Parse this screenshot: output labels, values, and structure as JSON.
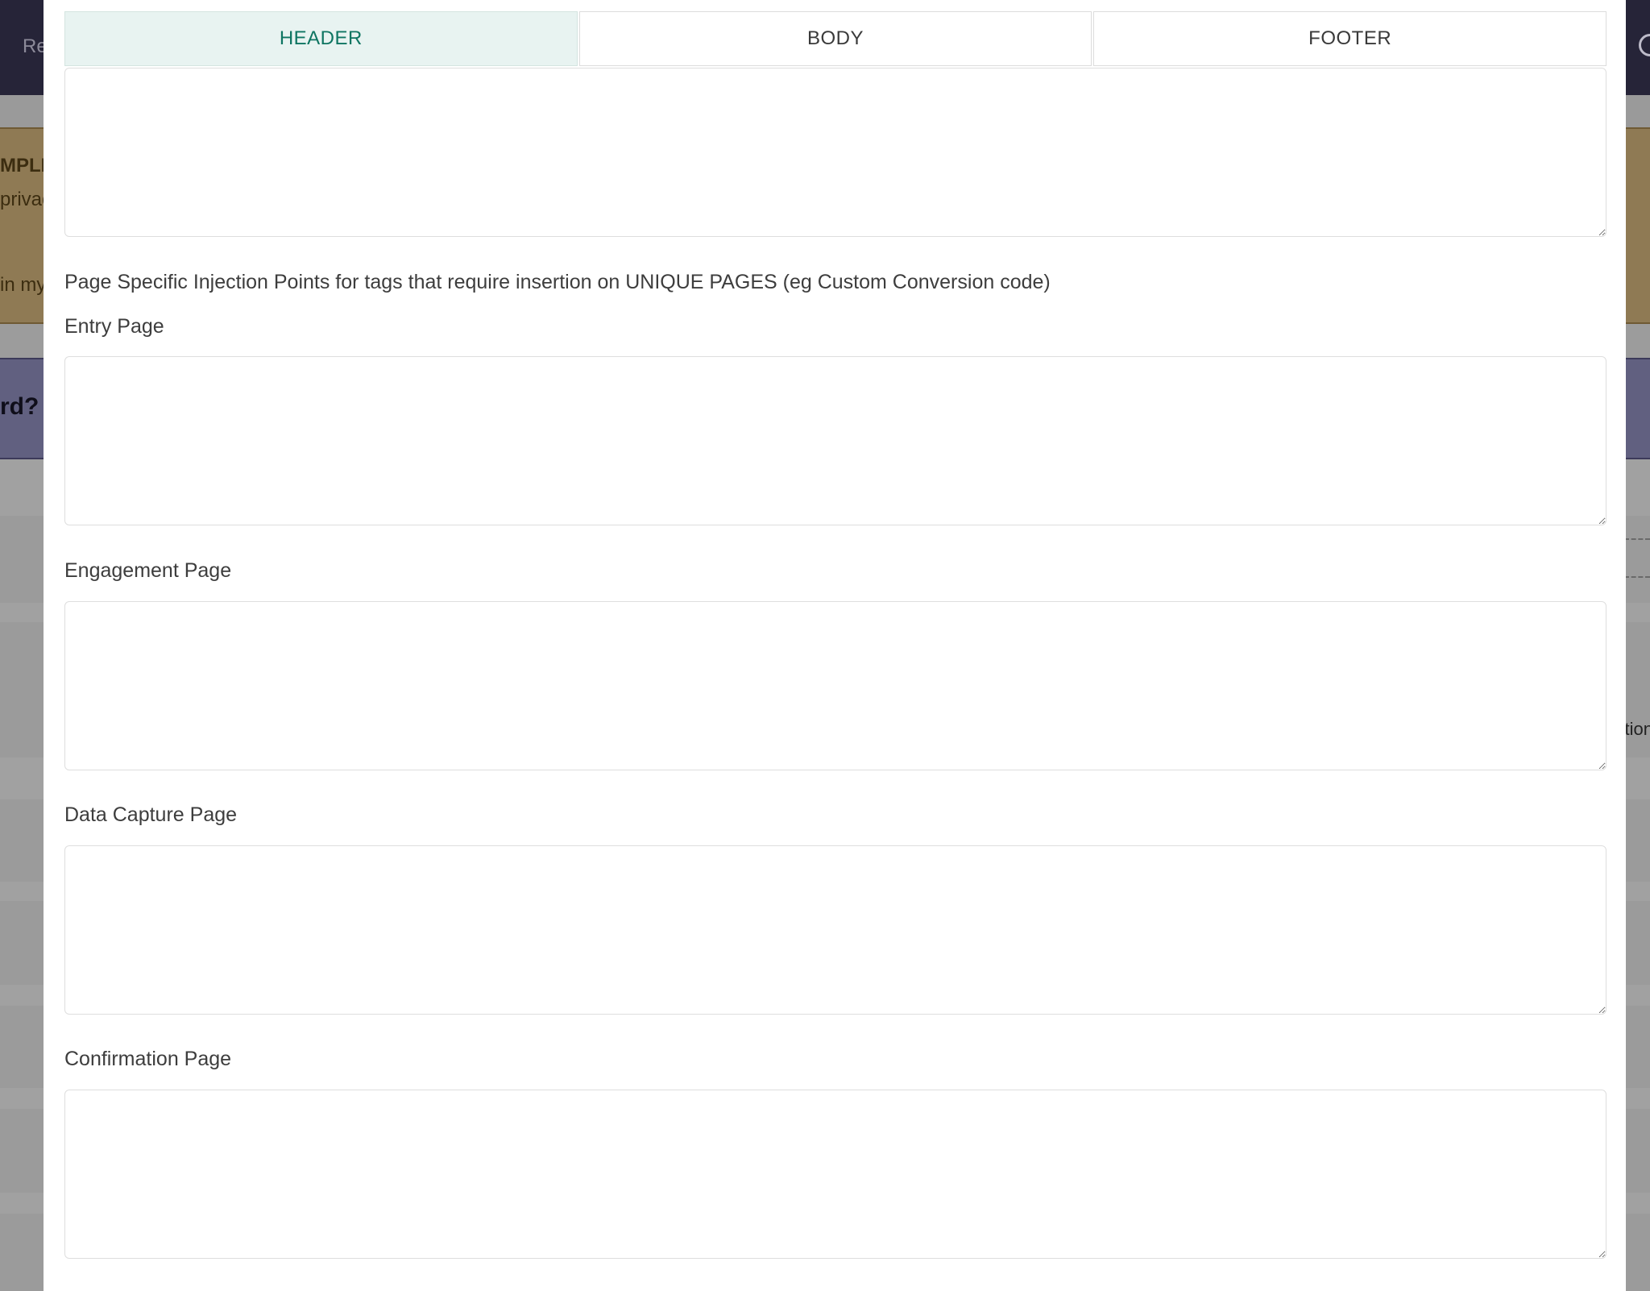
{
  "background": {
    "topbar_text": "Re",
    "compliance_title": "MPLIA",
    "compliance_line1": "privac",
    "compliance_line2": "in my",
    "purple_heading": "rd?",
    "right_text": "tion"
  },
  "tabs": [
    {
      "label": "HEADER",
      "active": true
    },
    {
      "label": "BODY",
      "active": false
    },
    {
      "label": "FOOTER",
      "active": false
    }
  ],
  "main_code": {
    "value": ""
  },
  "injection_note": "Page Specific Injection Points for tags that require insertion on UNIQUE PAGES (eg Custom Conversion code)",
  "fields": [
    {
      "label": "Entry Page",
      "value": ""
    },
    {
      "label": "Engagement Page",
      "value": ""
    },
    {
      "label": "Data Capture Page",
      "value": ""
    },
    {
      "label": "Confirmation Page",
      "value": ""
    }
  ],
  "colors": {
    "active_tab_bg": "#e8f3f1",
    "active_tab_text": "#0e7562"
  }
}
